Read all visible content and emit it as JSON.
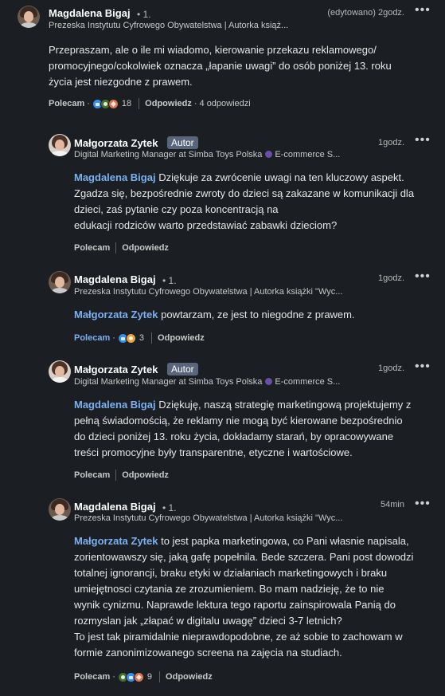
{
  "comments": [
    {
      "name": "Magdalena Bigaj",
      "degree": "• 1.",
      "headline": "Prezeska Instytutu Cyfrowego Obywatelstwa | Autorka książ...",
      "time": "(edytowano) 2godz.",
      "text_lines": [
        "Przepraszam, ale o ile mi wiadomo, kierowanie przekazu reklamowego/",
        "promocyjnego/cokolwiek oznacza „łapanie uwagi” do osób poniżej 13. roku",
        "życia jest niezgodne z prawem."
      ],
      "like_label": "Polecam",
      "reaction_count": "18",
      "reply_label": "Odpowiedz",
      "replies_count": "4 odpowiedzi"
    },
    {
      "name": "Małgorzata Zytek",
      "badge": "Autor",
      "headline": "Digital Marketing Manager at Simba Toys Polska",
      "headline_extra": "E-commerce S...",
      "time": "1godz.",
      "mention": "Magdalena Bigaj",
      "text_first": " Dziękuje za zwrócenie uwagi na ten kluczowy aspekt.",
      "text_lines": [
        "Zgadza się, bezpośrednie zwroty do dzieci są zakazane w komunikacji dla",
        "dzieci, zaś pytanie czy poza koncentracją na",
        "edukacji rodziców warto przedstawiać zabawki dzieciom?"
      ],
      "like_label": "Polecam",
      "reply_label": "Odpowiedz"
    },
    {
      "name": "Magdalena Bigaj",
      "degree": "• 1.",
      "headline": "Prezeska Instytutu Cyfrowego Obywatelstwa | Autorka książki \"Wyc...",
      "time": "1godz.",
      "mention": "Małgorzata Zytek",
      "text_first": " powtarzam, ze jest to niegodne z prawem.",
      "like_label": "Polecam",
      "reaction_count": "3",
      "reply_label": "Odpowiedz"
    },
    {
      "name": "Małgorzata Zytek",
      "badge": "Autor",
      "headline": "Digital Marketing Manager at Simba Toys Polska",
      "headline_extra": "E-commerce S...",
      "time": "1godz.",
      "mention": "Magdalena Bigaj",
      "text_first": " Dziękuję, naszą strategię marketingową projektujemy z",
      "text_lines": [
        "pełną świadomością, że reklamy nie mogą być kierowane bezpośrednio",
        "do dzieci poniżej 13. roku życia, dokładamy starań, by opracowywane",
        "treści promocyjne były transparentne, etyczne i wartościowe."
      ],
      "like_label": "Polecam",
      "reply_label": "Odpowiedz"
    },
    {
      "name": "Magdalena Bigaj",
      "degree": "• 1.",
      "headline": "Prezeska Instytutu Cyfrowego Obywatelstwa | Autorka książki \"Wyc...",
      "time": "54min",
      "mention": "Małgorzata Zytek",
      "text_first": " to jest papka marketingowa, co Pani własnie napisala,",
      "text_lines": [
        "zorientowawszy się, jaką gafę popełnila. Bede szczera. Pani post dowodzi",
        "totalnej ignorancji, braku etyki w działaniach marketingowych i braku",
        "umiejętnosci czytania ze zrozumieniem. Bo mam nadzieję, że to nie",
        "wynik cynizmu. Naprawde lektura tego raportu zainspirowala Panią do",
        "rozmyslan jak „złapać w digitalu uwagę” dzieci 3-7 letnich?",
        "To jest tak piramidalnie nieprawdopodobne, ze aż sobie to zachowam w",
        "formie zanonimizowanego screena na zajęcia na studiach."
      ],
      "like_label": "Polecam",
      "reaction_count": "9",
      "reply_label": "Odpowiedz"
    }
  ],
  "more_label": "•••",
  "colors": {
    "background": "#1b1f23",
    "mention": "#7cb0f0",
    "badge": "#58657a"
  }
}
